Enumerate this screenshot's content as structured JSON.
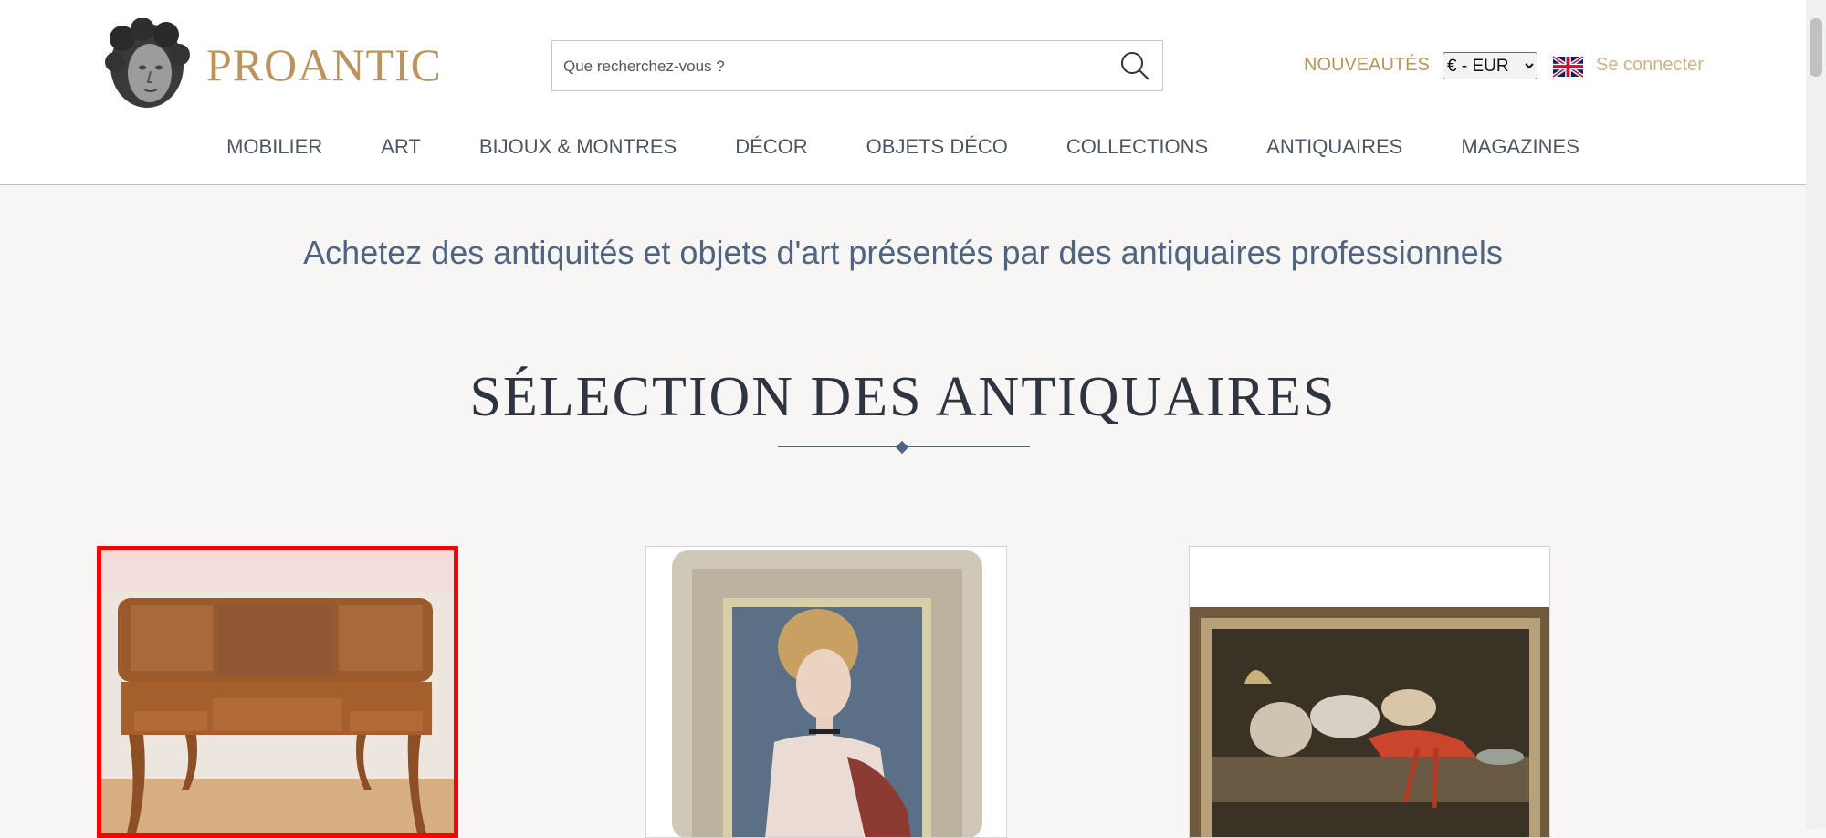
{
  "brand": {
    "name": "PROANTIC"
  },
  "search": {
    "placeholder": "Que recherchez-vous ?"
  },
  "header": {
    "new_label": "NOUVEAUTÉS",
    "currency_selected": "€ - EUR",
    "login_label": "Se connecter"
  },
  "nav": [
    {
      "label": "MOBILIER"
    },
    {
      "label": "ART"
    },
    {
      "label": "BIJOUX & MONTRES"
    },
    {
      "label": "DÉCOR"
    },
    {
      "label": "OBJETS DÉCO"
    },
    {
      "label": "COLLECTIONS"
    },
    {
      "label": "ANTIQUAIRES"
    },
    {
      "label": "MAGAZINES"
    }
  ],
  "main": {
    "tagline": "Achetez des antiquités et objets d'art présentés par des antiquaires professionnels",
    "section_title": "SÉLECTION DES ANTIQUAIRES"
  },
  "cards": [
    {
      "subject": "dressing-table",
      "highlighted": true
    },
    {
      "subject": "portrait-painting",
      "highlighted": false
    },
    {
      "subject": "still-life-painting",
      "highlighted": false
    }
  ],
  "colors": {
    "brand_gold": "#b8955e",
    "text_blue": "#4f6480",
    "highlight": "#ff0000"
  },
  "icons": [
    "search-icon",
    "uk-flag-icon",
    "logo-mark"
  ]
}
